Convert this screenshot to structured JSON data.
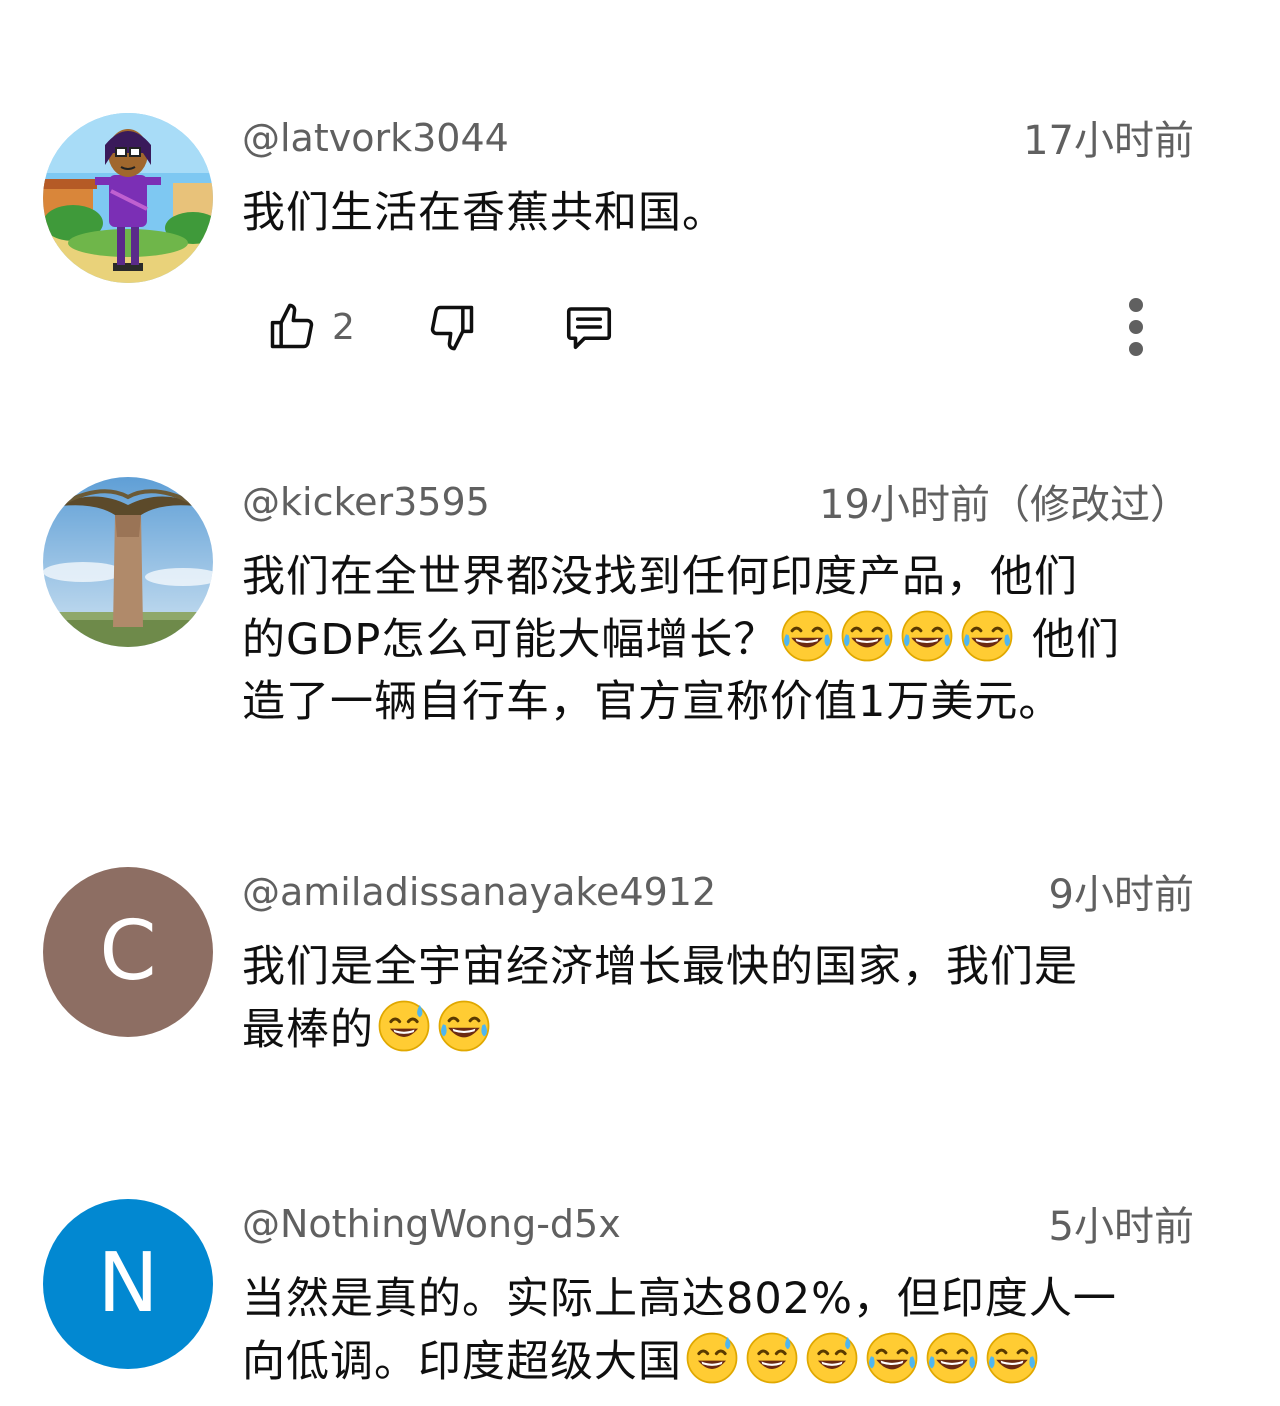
{
  "comments": [
    {
      "handle": "@latvork3044",
      "time": "17小时前",
      "text": "我们生活在香蕉共和国。",
      "like_count": "2",
      "avatar": "cartoon-avatar-icon"
    },
    {
      "handle": "@kicker3595",
      "time": "19小时前（修改过）",
      "text_line1": "我们在全世界都没找到任何印度产品，他们",
      "text_line2a": "的GDP怎么可能大幅增长？",
      "text_line2b": " 他们",
      "text_line3": "造了一辆自行车，官方宣称价值1万美元。",
      "avatar": "baobab-tree-avatar-icon"
    },
    {
      "handle": "@amiladissanayake4912",
      "time": "9小时前",
      "text_line1": "我们是全宇宙经济增长最快的国家，我们是",
      "text_line2": "最棒的",
      "avatar_letter": "C",
      "avatar_color": "#8d6e63"
    },
    {
      "handle": "@NothingWong-d5x",
      "time": "5小时前",
      "text_line1": "当然是真的。实际上高达802%，但印度人一",
      "text_line2": "向低调。印度超级大国",
      "avatar_letter": "N",
      "avatar_color": "#0288d1"
    }
  ],
  "icons": {
    "like": "thumbs-up-icon",
    "dislike": "thumbs-down-icon",
    "reply": "reply-comment-icon",
    "more": "more-vertical-icon",
    "emoji_laugh": "face-with-tears-of-joy",
    "emoji_sweat": "grinning-face-with-sweat"
  }
}
